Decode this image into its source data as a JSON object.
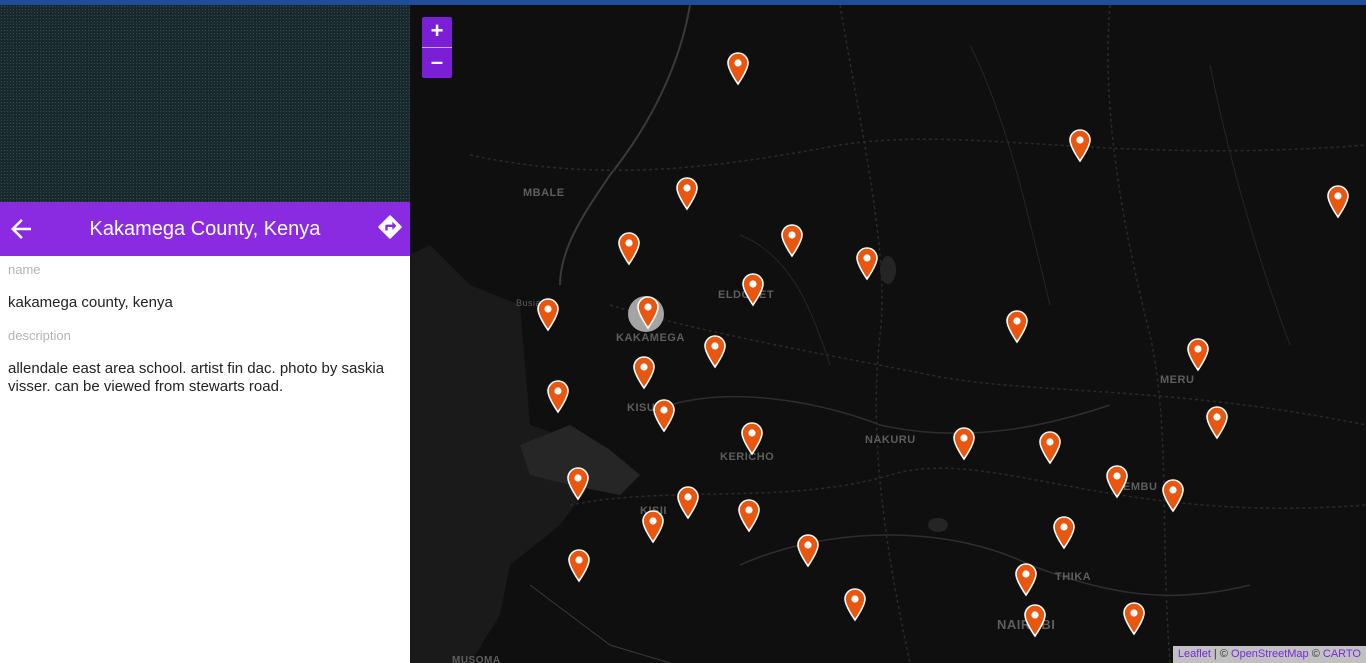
{
  "header": {
    "title": "Kakamega County, Kenya",
    "back_icon": "arrow-left-icon",
    "directions_icon": "directions-icon"
  },
  "details": {
    "name_label": "name",
    "name_value": "kakamega county, kenya",
    "description_label": "description",
    "description_value": "allendale east area school. artist fin dac. photo by saskia visser. can be viewed from stewarts road."
  },
  "map": {
    "zoom_in": "+",
    "zoom_out": "–",
    "places": [
      "MBALE",
      "ELDORET",
      "KAKAMEGA",
      "KISUMU",
      "KERICHO",
      "NAKURU",
      "MERU",
      "EMBU",
      "KISII",
      "THIKA",
      "NAIROBI",
      "Busia",
      "MUSOMA"
    ],
    "marker_color": "#e8560f",
    "accent_color": "#8a2be2",
    "attribution": {
      "leaflet": "Leaflet",
      "sep1": " | © ",
      "osm": "OpenStreetMap",
      "sep2": " © ",
      "carto": "CARTO"
    }
  }
}
